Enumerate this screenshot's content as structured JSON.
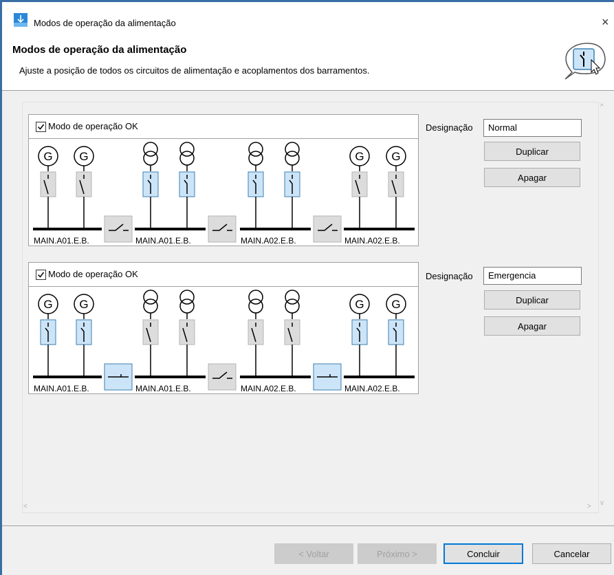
{
  "window": {
    "title": "Modos de operação da alimentação",
    "close_glyph": "×"
  },
  "header": {
    "title": "Modos de operação da alimentação",
    "description": "Ajuste a posição de todos os circuitos de alimentação e acoplamentos dos barramentos.",
    "help_icon": "switch-help-icon"
  },
  "modes": [
    {
      "checkbox_label": "Modo de operação OK",
      "checked": true,
      "designation_label": "Designação",
      "designation_value": "Normal",
      "duplicate_label": "Duplicar",
      "delete_label": "Apagar",
      "sources": [
        "generator",
        "generator",
        "transformer",
        "transformer",
        "transformer",
        "transformer",
        "generator",
        "generator"
      ],
      "feeder_states": [
        "open",
        "open",
        "closed",
        "closed",
        "closed",
        "closed",
        "open",
        "open"
      ],
      "coupler_states": [
        "open",
        "open",
        "open"
      ],
      "bus_labels": [
        "MAIN.A01.E.B.",
        "MAIN.A01.E.B.",
        "MAIN.A02.E.B.",
        "MAIN.A02.E.B."
      ]
    },
    {
      "checkbox_label": "Modo de operação OK",
      "checked": true,
      "designation_label": "Designação",
      "designation_value": "Emergencia",
      "duplicate_label": "Duplicar",
      "delete_label": "Apagar",
      "sources": [
        "generator",
        "generator",
        "transformer",
        "transformer",
        "transformer",
        "transformer",
        "generator",
        "generator"
      ],
      "feeder_states": [
        "closed",
        "closed",
        "open",
        "open",
        "open",
        "open",
        "closed",
        "closed"
      ],
      "coupler_states": [
        "closed",
        "open",
        "closed"
      ],
      "bus_labels": [
        "MAIN.A01.E.B.",
        "MAIN.A01.E.B.",
        "MAIN.A02.E.B.",
        "MAIN.A02.E.B."
      ]
    }
  ],
  "footer": {
    "back_label": "< Voltar",
    "next_label": "Próximo >",
    "finish_label": "Concluir",
    "cancel_label": "Cancelar"
  },
  "colors": {
    "closed_fill": "#cce4f7",
    "closed_stroke": "#3c7fb1",
    "open_fill": "#dcdcdc",
    "open_stroke": "#b4b4b4",
    "accent": "#0078d7"
  },
  "scroll_glyphs": {
    "up": "^",
    "down": "v",
    "left": "<",
    "right": ">"
  }
}
